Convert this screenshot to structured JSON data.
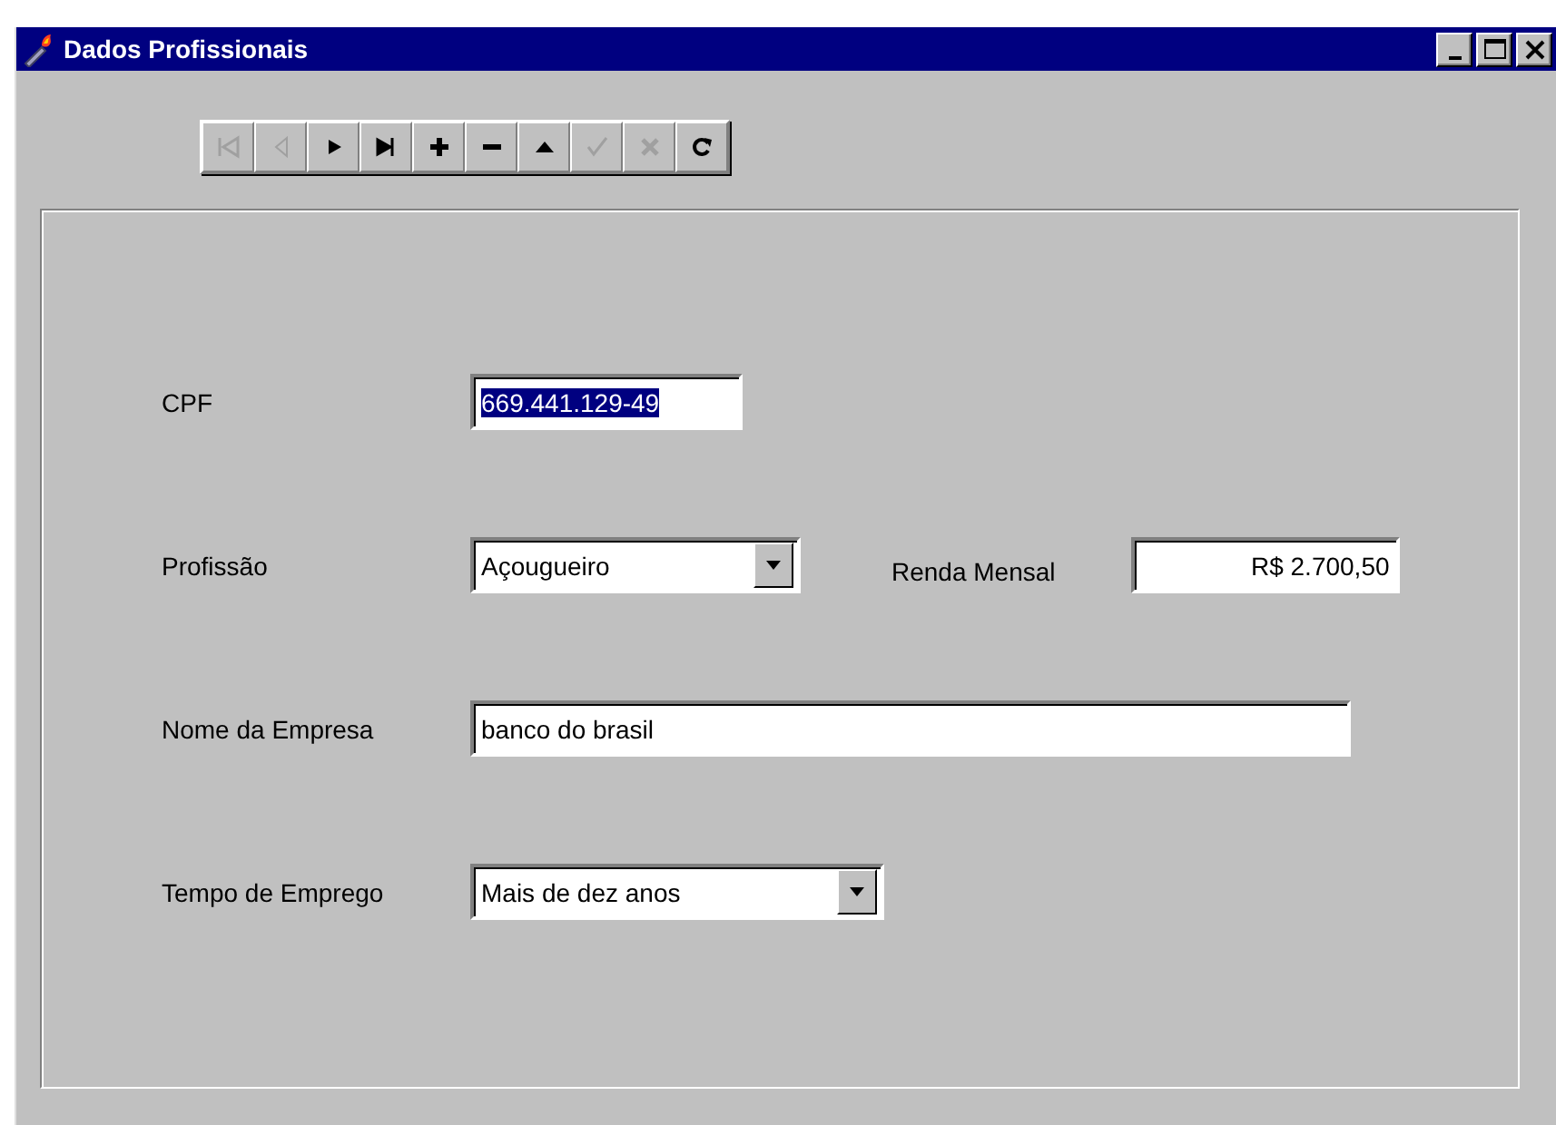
{
  "window": {
    "title": "Dados Profissionais",
    "controls": [
      {
        "kind": "minimize"
      },
      {
        "kind": "maximize"
      },
      {
        "kind": "close"
      }
    ]
  },
  "toolbar": [
    {
      "kind": "first",
      "disabled": true
    },
    {
      "kind": "prior",
      "disabled": true
    },
    {
      "kind": "next",
      "disabled": false
    },
    {
      "kind": "last",
      "disabled": false
    },
    {
      "kind": "insert",
      "disabled": false
    },
    {
      "kind": "delete",
      "disabled": false
    },
    {
      "kind": "edit",
      "disabled": false
    },
    {
      "kind": "post",
      "disabled": true
    },
    {
      "kind": "cancel",
      "disabled": true
    },
    {
      "kind": "refresh",
      "disabled": false
    }
  ],
  "form": [
    {
      "fields": [
        {
          "label": "CPF",
          "kind": "text",
          "value": "669.441.129-49",
          "text_selected": true
        }
      ]
    },
    {
      "fields": [
        {
          "label": "Profissão",
          "kind": "combo",
          "value": "Açougueiro"
        },
        {
          "label": "Renda Mensal",
          "kind": "number",
          "value": "R$ 2.700,50"
        }
      ]
    },
    {
      "fields": [
        {
          "label": "Nome da Empresa",
          "kind": "text",
          "value": "banco do brasil",
          "text_selected": false
        }
      ]
    },
    {
      "fields": [
        {
          "label": "Tempo de Emprego",
          "kind": "combo",
          "value": "Mais de dez anos"
        }
      ]
    }
  ]
}
